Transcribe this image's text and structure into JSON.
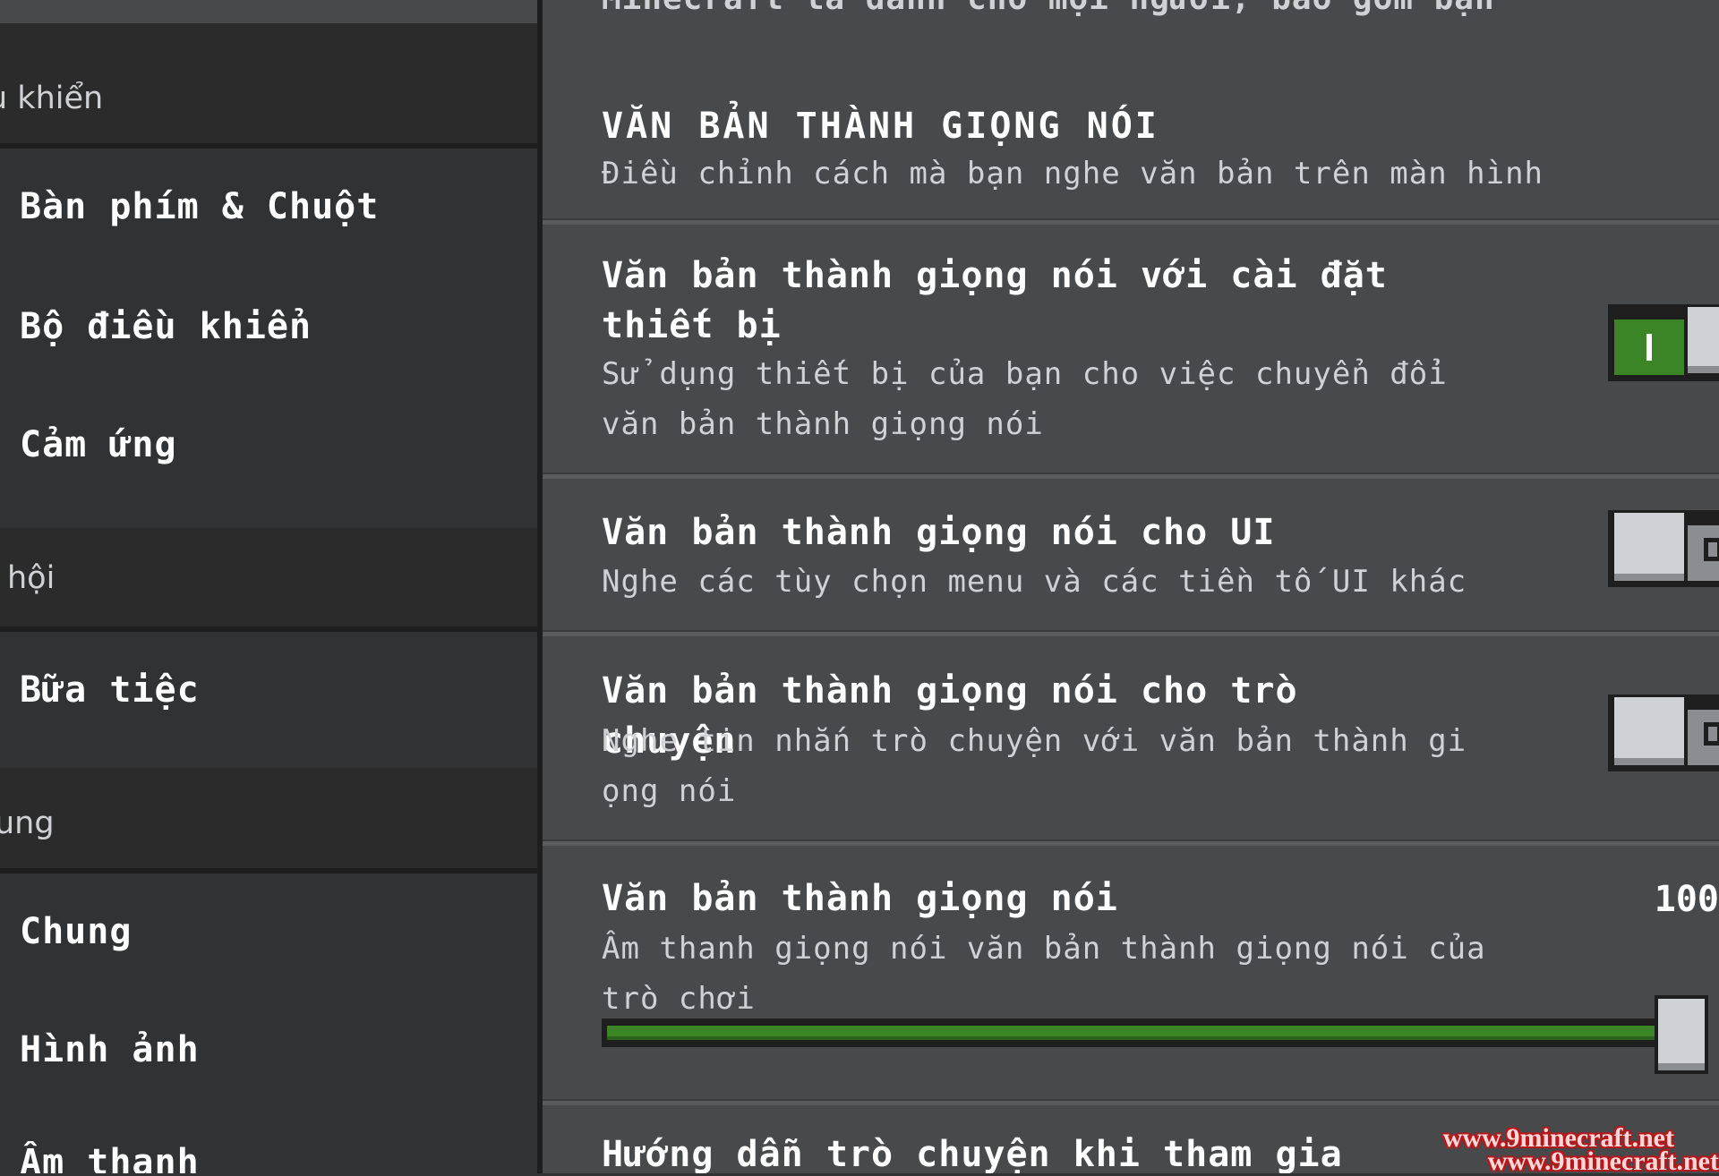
{
  "sidebar": {
    "sections": [
      {
        "label": "u khiển",
        "items": [
          "Bàn phím & Chuột",
          "Bộ điều khiển",
          "Cảm ứng"
        ]
      },
      {
        "label": "hội",
        "items": [
          "Bữa tiệc"
        ]
      },
      {
        "label": "ung",
        "items": [
          "Chung",
          "Hình ảnh",
          "Âm thanh"
        ]
      }
    ]
  },
  "main": {
    "top_cut_text": "Minecraft là dành cho mọi người, bao gồm bạn",
    "section": {
      "title": "VĂN BẢN THÀNH GIỌNG NÓI",
      "description": "Điều chỉnh cách mà bạn nghe văn bản trên màn hình"
    },
    "options": [
      {
        "title": "Văn bản thành giọng nói với cài đặt thiết bị",
        "description": "Sử dụng thiết bị của bạn cho việc chuyển đổi văn bản thành giọng nói",
        "enabled": true
      },
      {
        "title": "Văn bản thành giọng nói cho UI",
        "description": "Nghe các tùy chọn menu và các tiền tố UI khác",
        "enabled": false
      },
      {
        "title": "Văn bản thành giọng nói cho trò chuyện",
        "description": "Nghe tin nhắn trò chuyện với văn bản thành gi ọng nói",
        "enabled": false
      }
    ],
    "slider": {
      "title": "Văn bản thành giọng nói",
      "description": "Âm thanh giọng nói văn bản thành giọng nói của trò chơi",
      "value_label": "100",
      "value": 100,
      "max": 100
    },
    "next_option_title": "Hướng dẫn trò chuyện khi tham gia"
  },
  "watermark": {
    "line1": "www.9minecraft.net",
    "line2": "www.9minecraft.net"
  },
  "colors": {
    "accent_green": "#3c8527",
    "panel_bg": "#48494a",
    "sidebar_bg": "#313233"
  }
}
